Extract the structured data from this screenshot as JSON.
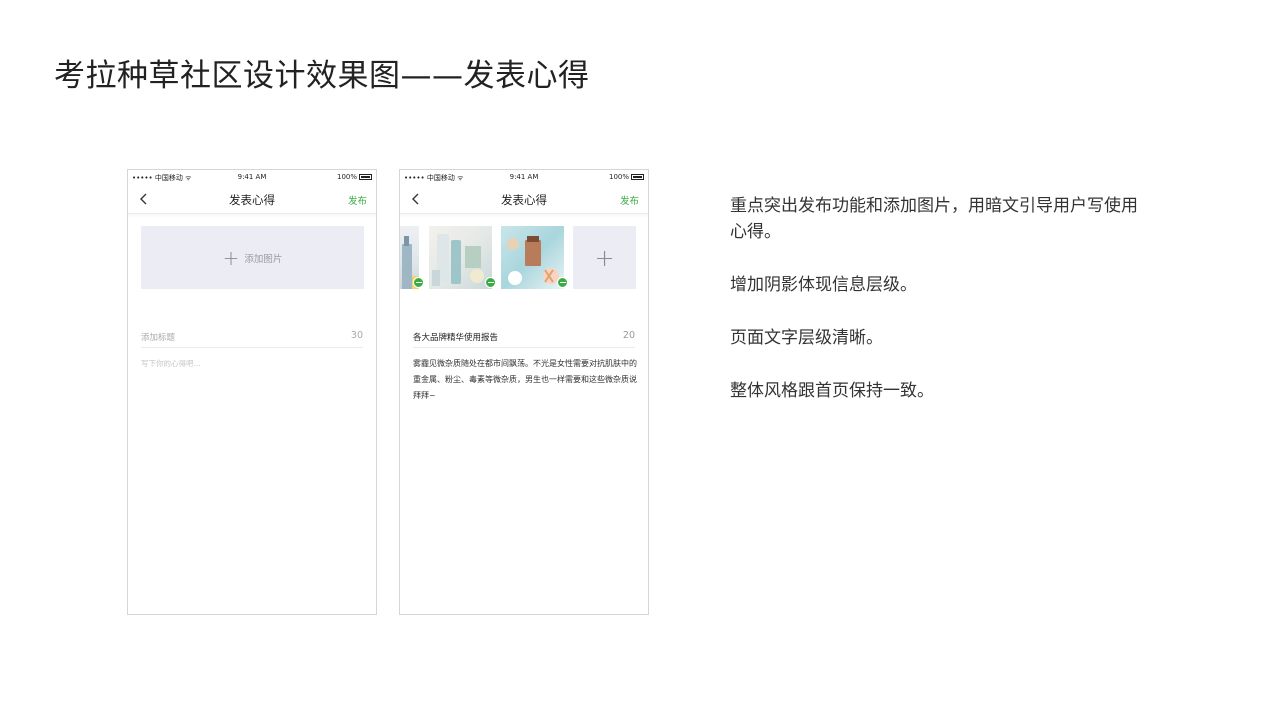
{
  "slide": {
    "title": "考拉种草社区设计效果图——发表心得"
  },
  "phones": {
    "phone1": {
      "status": {
        "carrier": "••••• 中国移动 ᯤ",
        "time": "9:41 AM",
        "battery": "100%"
      },
      "nav": {
        "title": "发表心得",
        "publish": "发布"
      },
      "add_photo_label": "添加图片",
      "title_field": {
        "placeholder": "添加标题",
        "count": "30"
      },
      "body_placeholder": "写下你的心得吧..."
    },
    "phone2": {
      "status": {
        "carrier": "••••• 中国移动 ᯤ",
        "time": "9:41 AM",
        "battery": "100%"
      },
      "nav": {
        "title": "发表心得",
        "publish": "发布"
      },
      "title_field": {
        "value": "各大品牌精华使用报告",
        "count": "20"
      },
      "body_text": "雾霾见微杂质随处在都市间飘荡。不光是女性需要对抗肌肤中的重金属、粉尘、毒素等微杂质，男生也一样需要和这些微杂质说拜拜~"
    }
  },
  "description": {
    "points": [
      "重点突出发布功能和添加图片，用暗文引导用户写使用心得。",
      "增加阴影体现信息层级。",
      "页面文字层级清晰。",
      "整体风格跟首页保持一致。"
    ]
  },
  "colors": {
    "accent_green": "#3bab43",
    "placeholder_bg": "#ececf5"
  }
}
